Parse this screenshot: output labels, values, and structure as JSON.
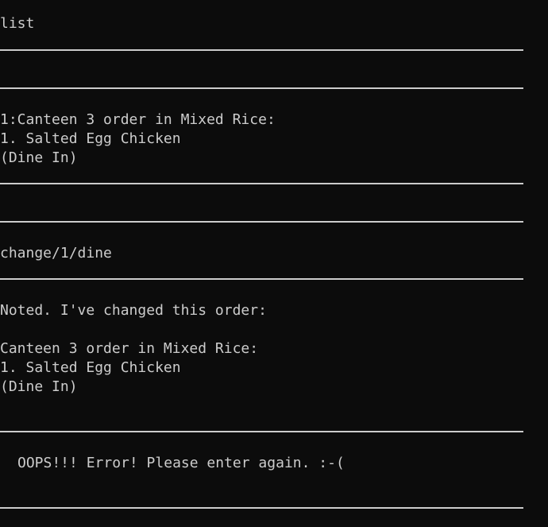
{
  "colors": {
    "background": "#0c0c0c",
    "foreground": "#cccccc"
  },
  "terminal": {
    "cmd_list": "list",
    "order_list_header": "1:Canteen 3 order in Mixed Rice:",
    "order_list_item": "1. Salted Egg Chicken",
    "order_list_mode": "(Dine In)",
    "cmd_change": "change/1/dine",
    "change_ack": "Noted. I've changed this order:",
    "changed_header": "Canteen 3 order in Mixed Rice:",
    "changed_item": "1. Salted Egg Chicken",
    "changed_mode": "(Dine In)",
    "error_message": "OOPS!!! Error! Please enter again. :-("
  }
}
